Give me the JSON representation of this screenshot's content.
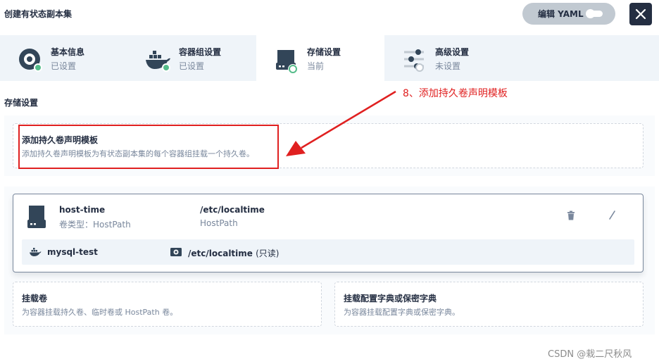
{
  "dialog": {
    "title": "创建有状态副本集",
    "yaml_label": "编辑 YAML"
  },
  "steps": [
    {
      "title": "基本信息",
      "status": "已设置",
      "icon": "disc-icon",
      "state": "done"
    },
    {
      "title": "容器组设置",
      "status": "已设置",
      "icon": "docker-whale-icon",
      "state": "done"
    },
    {
      "title": "存储设置",
      "status": "当前",
      "icon": "storage-disk-icon",
      "state": "current"
    },
    {
      "title": "高级设置",
      "status": "未设置",
      "icon": "sliders-icon",
      "state": "pending"
    }
  ],
  "storage": {
    "section_title": "存储设置",
    "pvc_template": {
      "title": "添加持久卷声明模板",
      "desc": "添加持久卷声明模板为有状态副本集的每个容器组挂载一个持久卷。"
    },
    "volume": {
      "name": "host-time",
      "type_label": "卷类型：HostPath",
      "mount_path": "/etc/localtime",
      "mount_type": "HostPath",
      "container": "mysql-test",
      "container_path": "/etc/localtime",
      "readonly_label": "(只读)"
    },
    "mount_volume": {
      "title": "挂载卷",
      "desc": "为容器挂载持久卷、临时卷或 HostPath 卷。"
    },
    "mount_config": {
      "title": "挂载配置字典或保密字典",
      "desc": "为容器挂载配置字典或保密字典。"
    }
  },
  "annotation": {
    "text": "8、添加持久卷声明模板",
    "color": "#e02020"
  },
  "watermark": "CSDN @栽二尺秋风",
  "colors": {
    "dark": "#242e42",
    "muted": "#79879c",
    "green": "#55bc8a",
    "tab_bg": "#eff4f9"
  }
}
